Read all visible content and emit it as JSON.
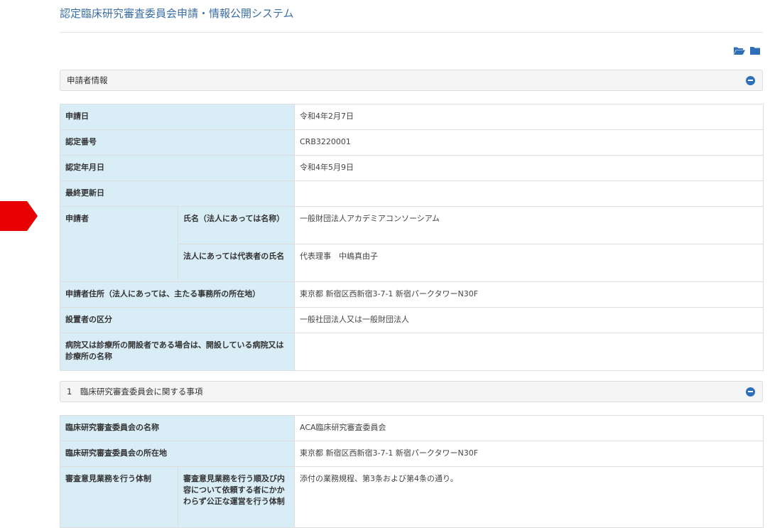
{
  "app_title": "認定臨床研究審査委員会申請・情報公開システム",
  "toolbar": {
    "open_icon": "folder-open-icon",
    "close_icon": "folder-icon"
  },
  "panel1": {
    "title": "申請者情報",
    "toggle_icon": "minus-circle-icon"
  },
  "table1": {
    "application_date": {
      "label": "申請日",
      "value": "令和4年2月7日"
    },
    "certification_number": {
      "label": "認定番号",
      "value": "CRB3220001"
    },
    "certification_date": {
      "label": "認定年月日",
      "value": "令和4年5月9日"
    },
    "last_updated": {
      "label": "最終更新日",
      "value": ""
    },
    "applicant": {
      "label": "申請者",
      "name_label": "氏名（法人にあっては名称）",
      "name_value": "一般財団法人アカデミアコンソーシアム",
      "rep_label": "法人にあっては代表者の氏名",
      "rep_value": "代表理事　中嶋真由子"
    },
    "address": {
      "label": "申請者住所（法人にあっては、主たる事務所の所在地）",
      "value": "東京都 新宿区西新宿3-7-1 新宿パークタワーN30F"
    },
    "founder_category": {
      "label": "設置者の区分",
      "value": "一般社団法人又は一般財団法人"
    },
    "hospital": {
      "label": "病院又は診療所の開設者である場合は、開設している病院又は診療所の名称",
      "value": ""
    }
  },
  "panel2": {
    "title": "1　臨床研究審査委員会に関する事項",
    "toggle_icon": "minus-circle-icon"
  },
  "table2": {
    "committee_name": {
      "label": "臨床研究審査委員会の名称",
      "value": "ACA臨床研究審査委員会"
    },
    "committee_location": {
      "label": "臨床研究審査委員会の所在地",
      "value": "東京都 新宿区西新宿3-7-1 新宿パークタワーN30F"
    },
    "review_system": {
      "label": "審査意見業務を行う体制",
      "sub_label": "審査意見業務を行う順及び内容について依頼する者にかかわらず公正な運営を行う体制",
      "value": "添付の業務規程、第3条および第4条の通り。"
    }
  },
  "colors": {
    "accent": "#2f6fb7",
    "label_bg": "#d9edf7",
    "arrow": "#e60000",
    "title": "#3a6ea5"
  }
}
